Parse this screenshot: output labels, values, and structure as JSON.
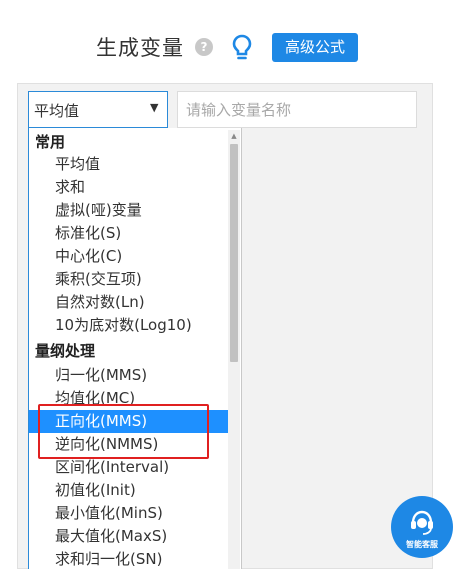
{
  "header": {
    "title": "生成变量",
    "help_icon_glyph": "?",
    "bulb_icon": "lightbulb-icon",
    "advanced_button": "高级公式"
  },
  "controls": {
    "select_value": "平均值",
    "select_arrow": "▼",
    "name_placeholder": "请输入变量名称"
  },
  "dropdown": {
    "groups": [
      {
        "label": "常用",
        "items": [
          "平均值",
          "求和",
          "虚拟(哑)变量",
          "标准化(S)",
          "中心化(C)",
          "乘积(交互项)",
          "自然对数(Ln)",
          "10为底对数(Log10)"
        ]
      },
      {
        "label": "量纲处理",
        "items": [
          "归一化(MMS)",
          "均值化(MC)",
          "正向化(MMS)",
          "逆向化(NMMS)",
          "区间化(Interval)",
          "初值化(Init)",
          "最小值化(MinS)",
          "最大值化(MaxS)",
          "求和归一化(SN)"
        ]
      }
    ],
    "selected_item": "正向化(MMS)",
    "scroll_up_glyph": "▲"
  },
  "chat": {
    "label": "智能客服",
    "icon": "headset-icon"
  },
  "colors": {
    "accent": "#1e88e5",
    "selected_bg": "#1e90ff",
    "highlight_border": "#e02020"
  }
}
